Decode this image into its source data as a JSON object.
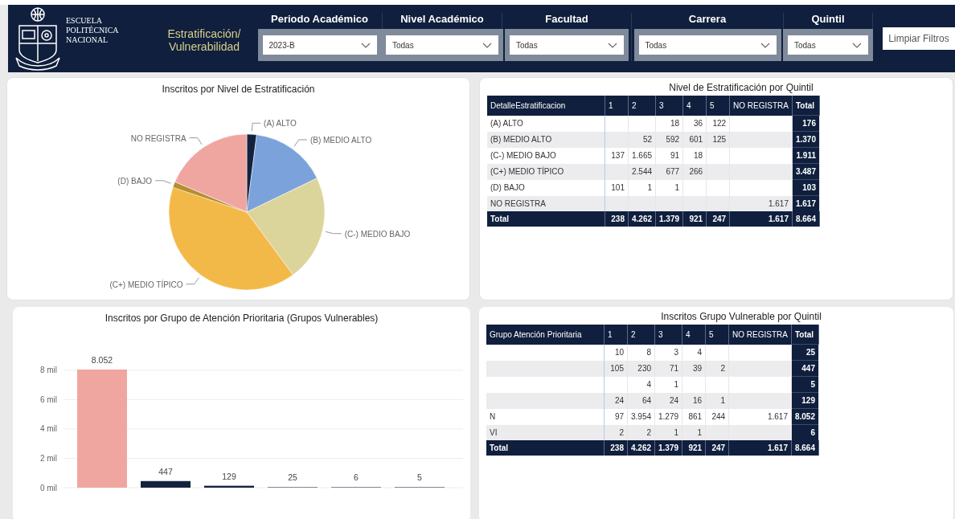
{
  "header": {
    "logo_lines": [
      "ESCUELA",
      "POLITÉCNICA",
      "NACIONAL"
    ],
    "title_lines": [
      "Estratificación/",
      "Vulnerabilidad"
    ],
    "filters": [
      {
        "label": "Periodo Académico",
        "value": "2023-B"
      },
      {
        "label": "Nivel Académico",
        "value": "Todas"
      },
      {
        "label": "Facultad",
        "value": "Todas"
      },
      {
        "label": "Carrera",
        "value": "Todas"
      },
      {
        "label": "Quintil",
        "value": "Todas"
      }
    ],
    "clear_button": "Limpiar Filtros"
  },
  "pie_panel": {
    "chart_data": {
      "type": "pie",
      "title": "Inscritos por Nivel de Estratificación",
      "categories": [
        "(A) ALTO",
        "(B) MEDIO ALTO",
        "(C-) MEDIO BAJO",
        "(C+) MEDIO TÍPICO",
        "(D) BAJO",
        "NO REGISTRA"
      ],
      "values": [
        2.03,
        15.81,
        22.06,
        40.25,
        1.19,
        18.66
      ],
      "colors": [
        "#13233f",
        "#7ba2db",
        "#dcd59b",
        "#f3b948",
        "#b58e2d",
        "#f0a6a0"
      ]
    }
  },
  "table1": {
    "title": "Nivel de Estratificación por Quintil",
    "columns": [
      "DetalleEstratificacion",
      "1",
      "2",
      "3",
      "4",
      "5",
      "NO REGISTRA",
      "Total"
    ],
    "rows": [
      [
        "(A) ALTO",
        "",
        "",
        "18",
        "36",
        "122",
        "",
        "176"
      ],
      [
        "(B) MEDIO ALTO",
        "",
        "52",
        "592",
        "601",
        "125",
        "",
        "1.370"
      ],
      [
        "(C-) MEDIO BAJO",
        "137",
        "1.665",
        "91",
        "18",
        "",
        "",
        "1.911"
      ],
      [
        "(C+) MEDIO TÍPICO",
        "",
        "2.544",
        "677",
        "266",
        "",
        "",
        "3.487"
      ],
      [
        "(D) BAJO",
        "101",
        "1",
        "1",
        "",
        "",
        "",
        "103"
      ],
      [
        "NO REGISTRA",
        "",
        "",
        "",
        "",
        "",
        "1.617",
        "1.617"
      ]
    ],
    "total_row": [
      "Total",
      "238",
      "4.262",
      "1.379",
      "921",
      "247",
      "1.617",
      "8.664"
    ]
  },
  "bar_panel": {
    "chart_data": {
      "type": "bar",
      "title": "Inscritos por Grupo de Atención Prioritaria (Grupos Vulnerables)",
      "categories": [
        null,
        null,
        null,
        null,
        null,
        null
      ],
      "values": [
        8.05,
        0.45,
        0.13,
        0.03,
        0.01,
        0.01
      ],
      "grid": true,
      "ylim": [
        0,
        8.1
      ],
      "yticks": [
        {
          "value": 0,
          "label": "0 mil"
        },
        {
          "value": 2,
          "label": "2 mil"
        },
        {
          "value": 4,
          "label": "4 mil"
        },
        {
          "value": 6,
          "label": "6 mil"
        },
        {
          "value": 8,
          "label": "8 mil"
        }
      ],
      "colors": [
        "#f0a6a0",
        "#13233f",
        "#13233f",
        "#7f8a9b",
        "#7f8a9b",
        "#7f8a9b"
      ]
    },
    "bar_labels": [
      "8.052",
      "447",
      "129",
      "25",
      "6",
      "5"
    ]
  },
  "table2": {
    "title": "Inscritos Grupo Vulnerable por Quintil",
    "columns": [
      "Grupo Atención Prioritaria",
      "1",
      "2",
      "3",
      "4",
      "5",
      "NO REGISTRA",
      "Total"
    ],
    "rows": [
      [
        "",
        "10",
        "8",
        "3",
        "4",
        "",
        "",
        "25"
      ],
      [
        "",
        "105",
        "230",
        "71",
        "39",
        "2",
        "",
        "447"
      ],
      [
        "",
        "",
        "4",
        "1",
        "",
        "",
        "",
        "5"
      ],
      [
        "",
        "24",
        "64",
        "24",
        "16",
        "1",
        "",
        "129"
      ],
      [
        "N",
        "97",
        "3.954",
        "1.279",
        "861",
        "244",
        "1.617",
        "8.052"
      ],
      [
        "VI",
        "2",
        "2",
        "1",
        "1",
        "",
        "",
        "6"
      ]
    ],
    "total_row": [
      "Total",
      "238",
      "4.262",
      "1.379",
      "921",
      "247",
      "1.617",
      "8.664"
    ]
  }
}
